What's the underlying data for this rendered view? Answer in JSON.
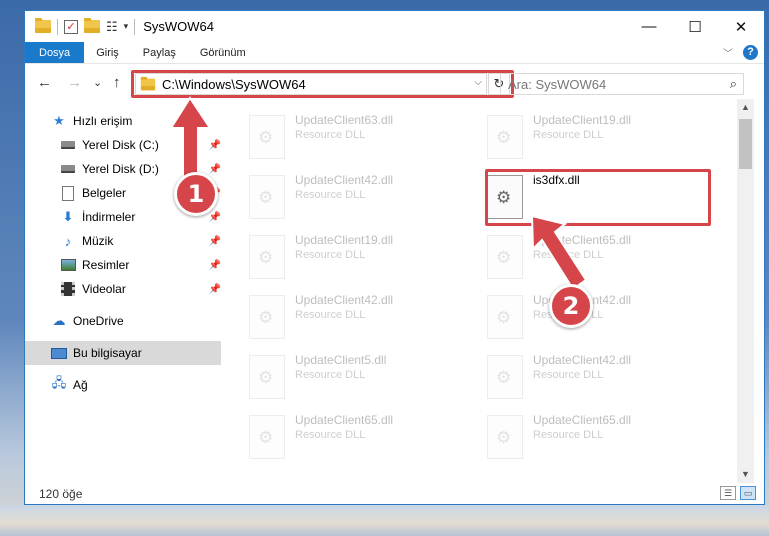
{
  "window": {
    "title": "SysWOW64",
    "controls": {
      "minimize": "—",
      "maximize": "☐",
      "close": "✕"
    }
  },
  "qat": {
    "dropdown": "▾"
  },
  "ribbon": {
    "tabs": [
      "Dosya",
      "Giriş",
      "Paylaş",
      "Görünüm"
    ],
    "help": "?"
  },
  "nav": {
    "back": "←",
    "forward": "→",
    "recent": "⌄",
    "up": "↑",
    "address": "C:\\Windows\\SysWOW64",
    "refresh": "↻",
    "search_placeholder": "Ara: SysWOW64"
  },
  "sidebar": {
    "items": [
      {
        "label": "Hızlı erişim",
        "icon": "star-icon",
        "pinned": false
      },
      {
        "label": "Yerel Disk (C:)",
        "icon": "drive-icon",
        "pinned": true
      },
      {
        "label": "Yerel Disk (D:)",
        "icon": "drive-icon",
        "pinned": true
      },
      {
        "label": "Belgeler",
        "icon": "documents-icon",
        "pinned": true
      },
      {
        "label": "İndirmeler",
        "icon": "downloads-icon",
        "pinned": true
      },
      {
        "label": "Müzik",
        "icon": "music-icon",
        "pinned": true
      },
      {
        "label": "Resimler",
        "icon": "pictures-icon",
        "pinned": true
      },
      {
        "label": "Videolar",
        "icon": "videos-icon",
        "pinned": true
      },
      {
        "label": "OneDrive",
        "icon": "onedrive-icon",
        "pinned": false
      },
      {
        "label": "Bu bilgisayar",
        "icon": "this-pc-icon",
        "pinned": false
      },
      {
        "label": "Ağ",
        "icon": "network-icon",
        "pinned": false
      }
    ]
  },
  "files": [
    {
      "name": "UpdateClient63.dll",
      "type": "Resource DLL"
    },
    {
      "name": "UpdateClient19.dll",
      "type": "Resource DLL"
    },
    {
      "name": "UpdateClient42.dll",
      "type": "Resource DLL"
    },
    {
      "name": "is3dfx.dll",
      "type": ""
    },
    {
      "name": "UpdateClient19.dll",
      "type": "Resource DLL"
    },
    {
      "name": "UpdateClient65.dll",
      "type": "Resource DLL"
    },
    {
      "name": "UpdateClient42.dll",
      "type": "Resource DLL"
    },
    {
      "name": "UpdateClient42.dll",
      "type": "Resource DLL"
    },
    {
      "name": "UpdateClient5.dll",
      "type": "Resource DLL"
    },
    {
      "name": "UpdateClient42.dll",
      "type": "Resource DLL"
    },
    {
      "name": "UpdateClient65.dll",
      "type": "Resource DLL"
    },
    {
      "name": "UpdateClient65.dll",
      "type": "Resource DLL"
    }
  ],
  "status": {
    "count": "120 öğe"
  },
  "annotations": {
    "step1": "1",
    "step2": "2",
    "color": "#d6454a"
  }
}
